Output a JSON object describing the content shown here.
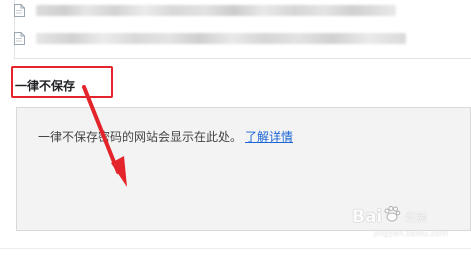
{
  "never_saved": {
    "title": "一律不保存",
    "message": "一律不保存密码的网站会显示在此处。",
    "learn_more": "了解详情"
  },
  "saved_rows": [
    {
      "icon": "page-icon"
    },
    {
      "icon": "page-icon"
    }
  ],
  "annotation": {
    "highlight_color": "#e3242b"
  },
  "watermark": {
    "brand_left": "Bai",
    "brand_right": "经验",
    "url": "jingyan.baidu.com"
  },
  "colors": {
    "link": "#1a66d6",
    "panel_bg": "#f3f3f3"
  }
}
